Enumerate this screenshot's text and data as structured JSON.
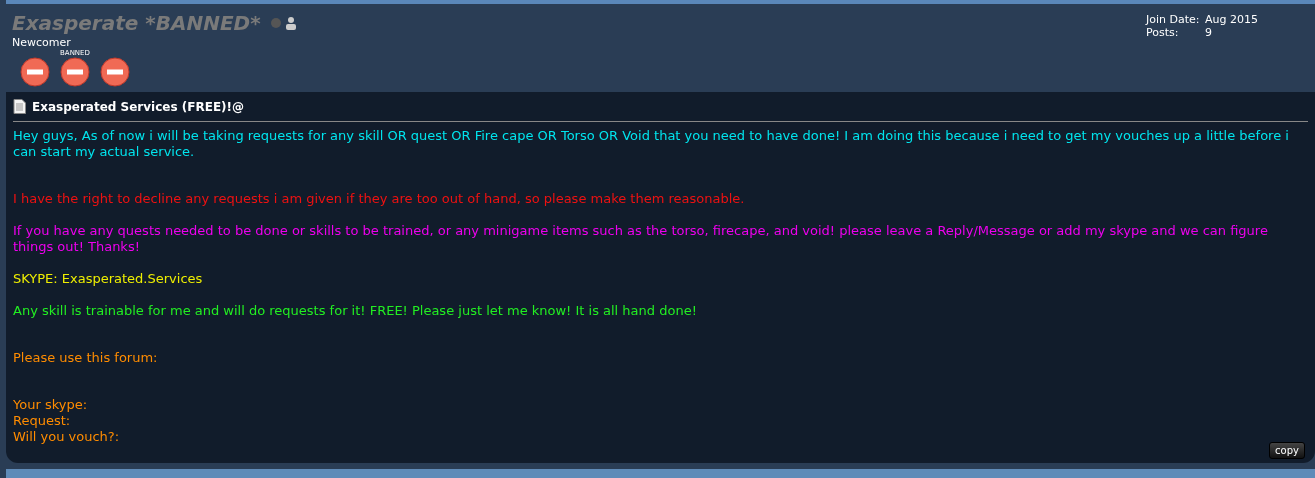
{
  "user": {
    "name": "Exasperate *BANNED*",
    "online": false,
    "rank": "Newcomer",
    "badges": [
      {
        "kind": "banned"
      },
      {
        "kind": "banned",
        "label": "BANNED"
      },
      {
        "kind": "banned"
      }
    ]
  },
  "stats": [
    {
      "label": "Join Date:",
      "value": "Aug 2015"
    },
    {
      "label": "Posts:",
      "value": "9"
    }
  ],
  "post": {
    "title": "Exasperated Services (FREE)!@",
    "paragraphs": [
      {
        "color": "#00e5ee",
        "lines": [
          "Hey guys, As of now i will be taking requests for any skill OR quest OR Fire cape OR Torso OR Void that you need to have done! I am doing this because i need to get my vouches up a little before i can start my actual service."
        ]
      },
      {
        "color": "#ee1111",
        "lines": [
          "I have the right to decline any requests i am given if they are too out of hand, so please make them reasonable."
        ]
      },
      {
        "color": "#ee00ee",
        "lines": [
          "If you have any quests needed to be done or skills to be trained, or any minigame items such as the torso, firecape, and void! please leave a Reply/Message or add my skype and we can figure things out! Thanks!"
        ]
      },
      {
        "color": "#eeee00",
        "lines": [
          "SKYPE: Exasperated.Services"
        ]
      },
      {
        "color": "#22ee22",
        "lines": [
          "Any skill is trainable for me and will do requests for it! FREE! Please just let me know! It is all hand done!"
        ]
      },
      {
        "color": "#ff8c00",
        "lines": [
          "Please use this forum:"
        ]
      },
      {
        "color": "#ff8c00",
        "lines": [
          "Your skype:",
          "Request:",
          "Will you vouch?:"
        ]
      }
    ],
    "copy_button": "copy"
  }
}
